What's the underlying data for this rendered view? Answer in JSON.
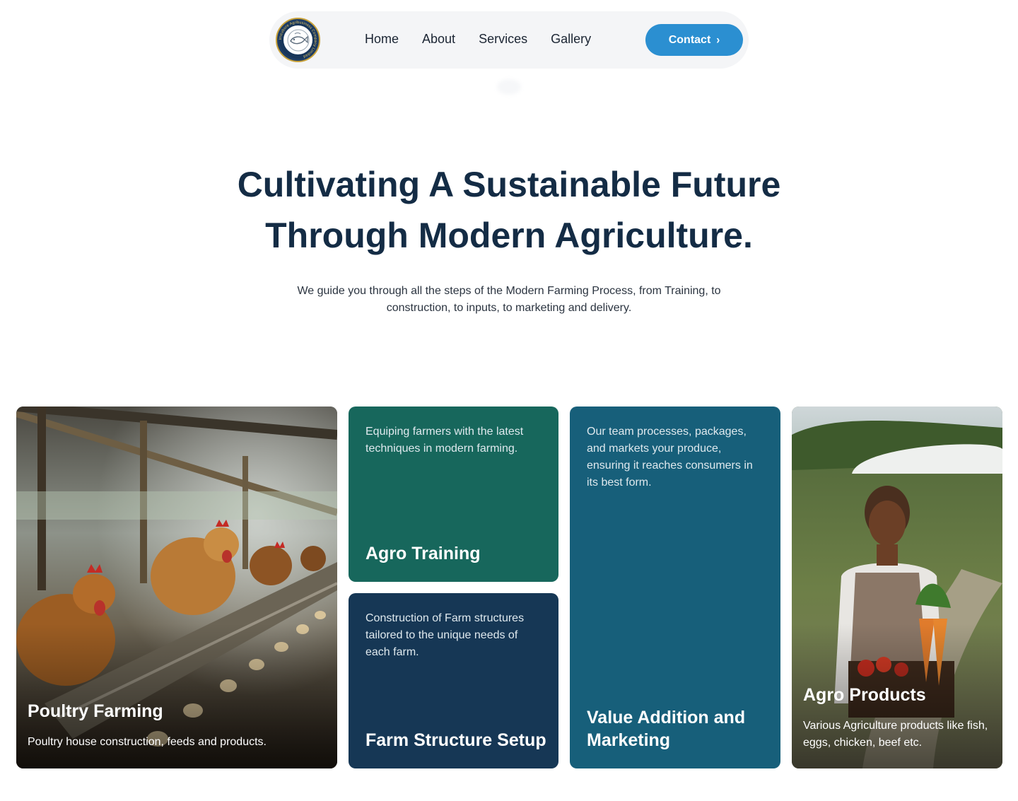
{
  "nav": {
    "logo_text": "Imevbore Agribusiness Company Limited",
    "links": [
      {
        "label": "Home"
      },
      {
        "label": "About"
      },
      {
        "label": "Services"
      },
      {
        "label": "Gallery"
      }
    ],
    "contact_label": "Contact",
    "accent_color": "#2b8fd1"
  },
  "hero": {
    "title_line1": "Cultivating A Sustainable Future",
    "title_line2": "Through Modern Agriculture.",
    "subtitle": "We guide you through all the steps of the Modern Farming Process, from Training, to construction, to inputs, to marketing and delivery."
  },
  "cards": {
    "poultry": {
      "title": "Poultry Farming",
      "description": "Poultry house construction, feeds and products."
    },
    "training": {
      "title": "Agro Training",
      "description": "Equiping farmers with the latest techniques in modern farming.",
      "color": "#17675c"
    },
    "structure": {
      "title": "Farm Structure Setup",
      "description": "Construction of Farm structures tailored to the unique needs of each farm.",
      "color": "#163755"
    },
    "value": {
      "title": "Value Addition and Marketing",
      "description": "Our team processes, packages, and markets your produce, ensuring it reaches consumers in its best form.",
      "color": "#175f7a"
    },
    "products": {
      "title": "Agro Products",
      "description": "Various Agriculture products like fish, eggs, chicken, beef etc."
    }
  }
}
